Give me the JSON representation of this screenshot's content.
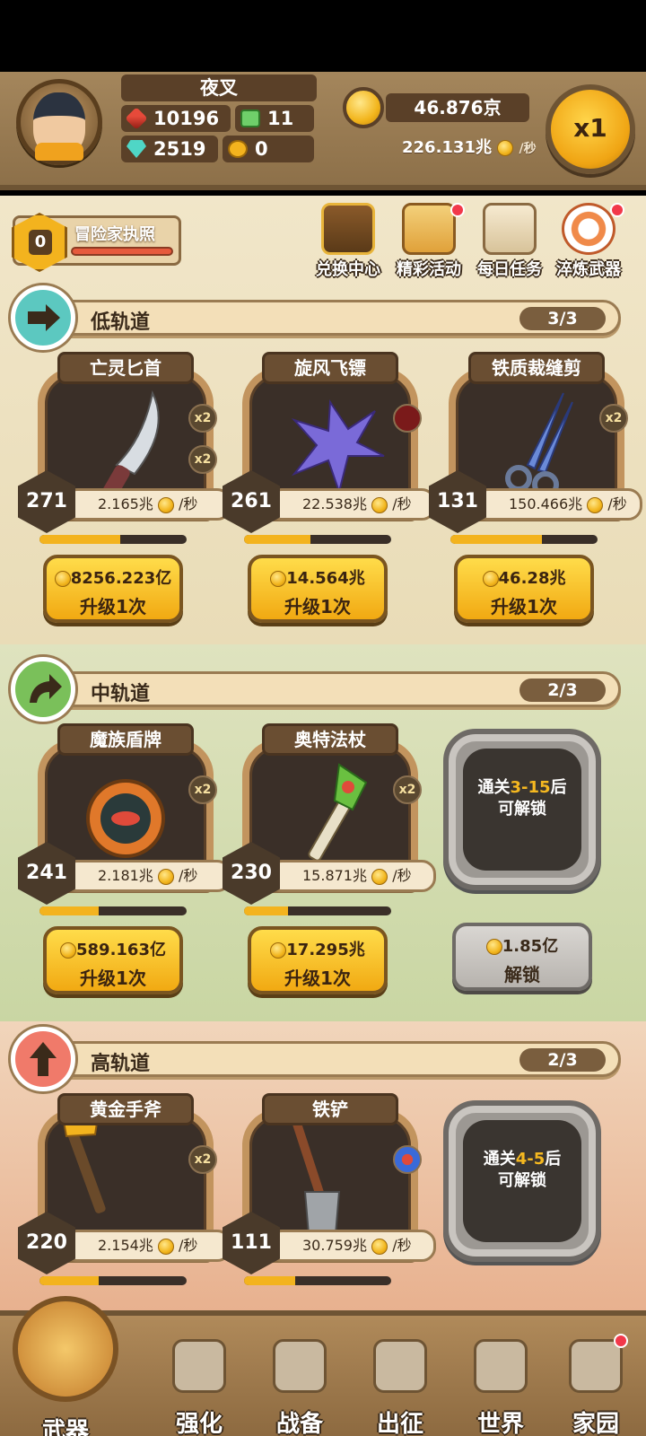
{
  "player": {
    "name": "夜叉",
    "power": "10196",
    "tickets": "11",
    "gems": "2519",
    "gold_tokens": "0"
  },
  "currency": {
    "gold": "46.876京",
    "income": "226.131兆",
    "income_unit": "/秒",
    "multiplier": "x1"
  },
  "license": {
    "level": "0",
    "title": "冒险家执照"
  },
  "menu": [
    {
      "label": "兑换中心",
      "icon": "treasure-chest-icon",
      "dot": false
    },
    {
      "label": "精彩活动",
      "icon": "gift-scroll-icon",
      "dot": true
    },
    {
      "label": "每日任务",
      "icon": "task-scroll-icon",
      "dot": false
    },
    {
      "label": "淬炼武器",
      "icon": "refine-x2-icon",
      "dot": true
    }
  ],
  "tracks": {
    "low": {
      "title": "低轨道",
      "count": "3/3",
      "weapons": [
        {
          "name": "亡灵匕首",
          "level": "271",
          "rate": "2.165兆",
          "rate_unit": "/秒",
          "cost": "8256.223亿",
          "action": "升级1次",
          "badges": [
            "x2",
            "x2"
          ],
          "progress": 0.55
        },
        {
          "name": "旋风飞镖",
          "level": "261",
          "rate": "22.538兆",
          "rate_unit": "/秒",
          "cost": "14.564兆",
          "action": "升级1次",
          "badges": [],
          "progress": 0.45
        },
        {
          "name": "铁质裁缝剪",
          "level": "131",
          "rate": "150.466兆",
          "rate_unit": "/秒",
          "cost": "46.28兆",
          "action": "升级1次",
          "badges": [
            "x2"
          ],
          "progress": 0.62
        }
      ]
    },
    "mid": {
      "title": "中轨道",
      "count": "2/3",
      "weapons": [
        {
          "name": "魔族盾牌",
          "level": "241",
          "rate": "2.181兆",
          "rate_unit": "/秒",
          "cost": "589.163亿",
          "action": "升级1次",
          "badges": [
            "x2"
          ],
          "progress": 0.4
        },
        {
          "name": "奥特法杖",
          "level": "230",
          "rate": "15.871兆",
          "rate_unit": "/秒",
          "cost": "17.295兆",
          "action": "升级1次",
          "badges": [
            "x2"
          ],
          "progress": 0.3
        }
      ],
      "locked": {
        "pre": "通关",
        "stage": "3-15",
        "post": "后",
        "line2": "可解锁",
        "cost": "1.85亿",
        "action": "解锁"
      }
    },
    "high": {
      "title": "高轨道",
      "count": "2/3",
      "weapons": [
        {
          "name": "黄金手斧",
          "level": "220",
          "rate": "2.154兆",
          "rate_unit": "/秒",
          "badges": [
            "x2"
          ],
          "progress": 0.4
        },
        {
          "name": "铁铲",
          "level": "111",
          "rate": "30.759兆",
          "rate_unit": "/秒",
          "badges": [],
          "progress": 0.35
        }
      ],
      "locked": {
        "pre": "通关",
        "stage": "4-5",
        "post": "后",
        "line2": "可解锁"
      }
    }
  },
  "nav": [
    {
      "label": "武器",
      "active": true
    },
    {
      "label": "强化",
      "active": false
    },
    {
      "label": "战备",
      "active": false
    },
    {
      "label": "出征",
      "active": false
    },
    {
      "label": "世界",
      "active": false
    },
    {
      "label": "家园",
      "active": false
    }
  ],
  "colors": {
    "gold": "#f3b31e",
    "brown": "#5a4028",
    "low_track": "#5cc8c0",
    "mid_track": "#7ac05a",
    "high_track": "#f07a6a"
  }
}
